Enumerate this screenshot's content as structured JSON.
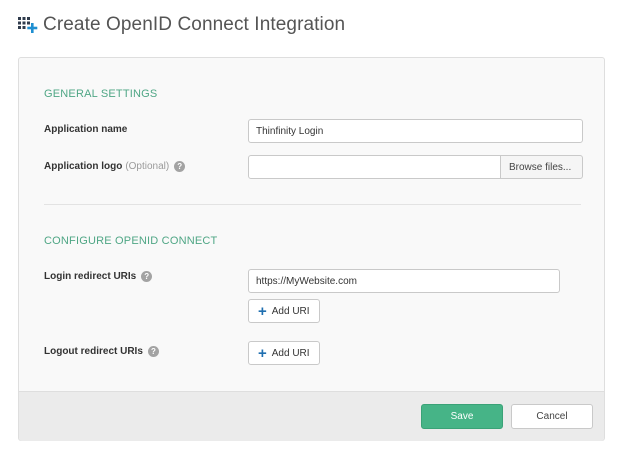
{
  "header": {
    "icon": "app-grid-add-icon",
    "title": "Create OpenID Connect Integration"
  },
  "general": {
    "title": "GENERAL SETTINGS",
    "app_name_label": "Application name",
    "app_name_value": "Thinfinity Login",
    "app_logo_label": "Application logo",
    "app_logo_optional": "(Optional)",
    "app_logo_value": "",
    "browse_label": "Browse files..."
  },
  "oidc": {
    "title": "CONFIGURE OPENID CONNECT",
    "login_label": "Login redirect URIs",
    "login_value": "https://MyWebsite.com",
    "logout_label": "Logout redirect URIs",
    "add_uri_label": "Add URI"
  },
  "help_glyph": "?",
  "plus_glyph": "+",
  "footer": {
    "save_label": "Save",
    "cancel_label": "Cancel"
  },
  "colors": {
    "section_title": "#4fa685",
    "save_button": "#46b487",
    "plus_icon": "#1f6fb0"
  }
}
